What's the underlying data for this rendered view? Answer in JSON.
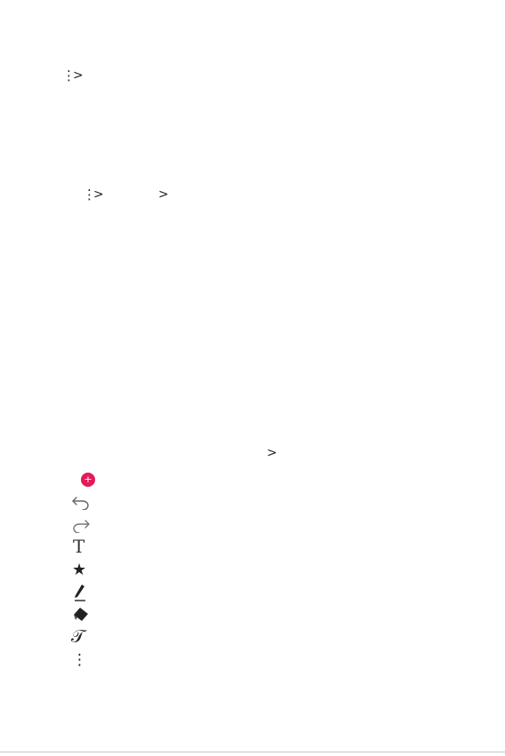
{
  "path1": {
    "more_icon": "more-vertical-icon",
    "chevron": ">"
  },
  "path2": {
    "more_icon": "more-vertical-icon",
    "chevron1": ">",
    "chevron2": ">"
  },
  "path3": {
    "chevron": ">"
  },
  "toolbar": {
    "items": [
      {
        "icon": "add-icon",
        "color": "#e5195a",
        "symbol": "+"
      },
      {
        "icon": "undo-icon"
      },
      {
        "icon": "redo-icon"
      },
      {
        "icon": "text-icon",
        "symbol": "T"
      },
      {
        "icon": "star-icon",
        "symbol": "★"
      },
      {
        "icon": "pen-icon"
      },
      {
        "icon": "eraser-icon"
      },
      {
        "icon": "handwriting-icon",
        "symbol": "𝒯"
      },
      {
        "icon": "more-vertical-icon",
        "symbol": "⋮"
      }
    ]
  }
}
